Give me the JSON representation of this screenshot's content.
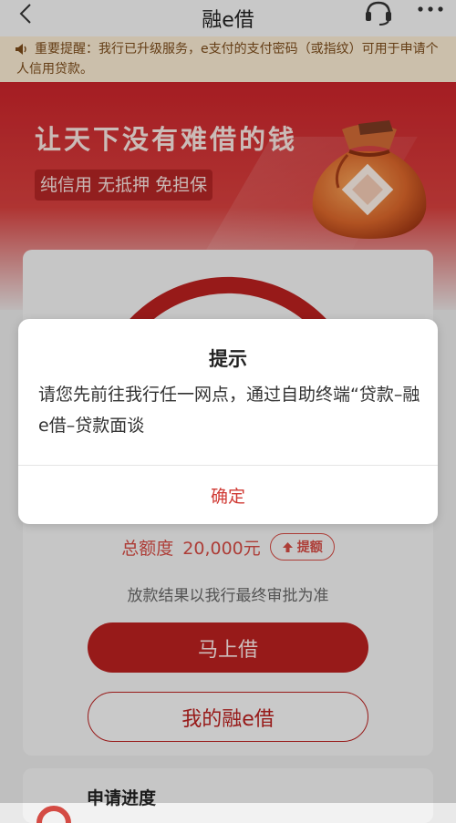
{
  "header": {
    "title": "融e借",
    "icons": [
      "back-arrow-icon",
      "headset-icon",
      "more-icon"
    ]
  },
  "notice": {
    "text": "重要提醒：我行已升级服务，e支付的支付密码（或指纹）可用于申请个人信用贷款。"
  },
  "hero": {
    "slogan": "让天下没有难借的钱",
    "tagline": "纯信用 无抵押 免担保"
  },
  "loan_card": {
    "quota_label": "总额度",
    "quota_value": "20,000元",
    "raise_button": "提额",
    "disclaimer": "放款结果以我行最终审批为准",
    "borrow_button": "马上借",
    "my_loan_button": "我的融e借"
  },
  "progress": {
    "title": "申请进度"
  },
  "dialog": {
    "title": "提示",
    "message": "请您先前往我行任一网点，通过自助终端“贷款–融e借–贷款面谈",
    "confirm_button": "确定"
  },
  "colors": {
    "brand_red": "#b9201f",
    "notice_bg": "#f8e9d1",
    "accent_text": "#d44b44"
  }
}
